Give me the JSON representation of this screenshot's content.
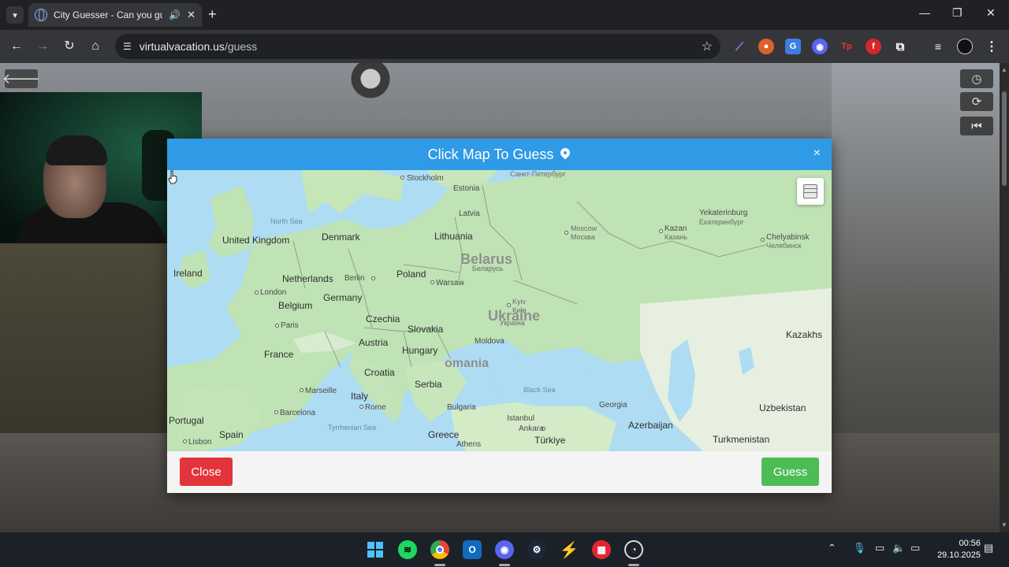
{
  "browser": {
    "tab_title": "City Guesser - Can you gue",
    "url_host": "virtualvacation.us",
    "url_path": "/guess",
    "new_tab": "+",
    "minimize": "—",
    "maximize": "❐",
    "close": "✕"
  },
  "modal": {
    "title": "Click Map To Guess",
    "close_symbol": "×",
    "close_button": "Close",
    "guess_button": "Guess"
  },
  "map": {
    "countries": [
      "United Kingdom",
      "Ireland",
      "Denmark",
      "Netherlands",
      "Belgium",
      "Germany",
      "France",
      "Poland",
      "Czechia",
      "Slovakia",
      "Austria",
      "Hungary",
      "Croatia",
      "Serbia",
      "Italy",
      "Spain",
      "Portugal",
      "Greece",
      "Bulgaria",
      "Türkiye",
      "Georgia",
      "Azerbaijan",
      "Turkmenistan",
      "Uzbekistan",
      "Kazakhs",
      "Belarus",
      "Lithuania",
      "Latvia",
      "Estonia",
      "Moldova",
      "Ukraine",
      "omania"
    ],
    "cities": [
      "Stockholm",
      "London",
      "Paris",
      "Berlin",
      "Warsaw",
      "Kyiv",
      "Moscow",
      "Kazan",
      "Yekaterinburg",
      "Chelyabinsk",
      "Marseille",
      "Barcelona",
      "Rome",
      "Lisbon",
      "Athens",
      "Istanbul",
      "Ankara"
    ],
    "cyrillic": [
      "Санкт-Петербург",
      "Москва",
      "Казань",
      "Екатеринбург",
      "Челябинск",
      "Київ",
      "Україна",
      "Беларусь"
    ],
    "seas": [
      "North Sea",
      "Black Sea",
      "Tyrrhenian Sea"
    ]
  },
  "clock": {
    "time": "00:56",
    "date": "29.10.2025"
  }
}
